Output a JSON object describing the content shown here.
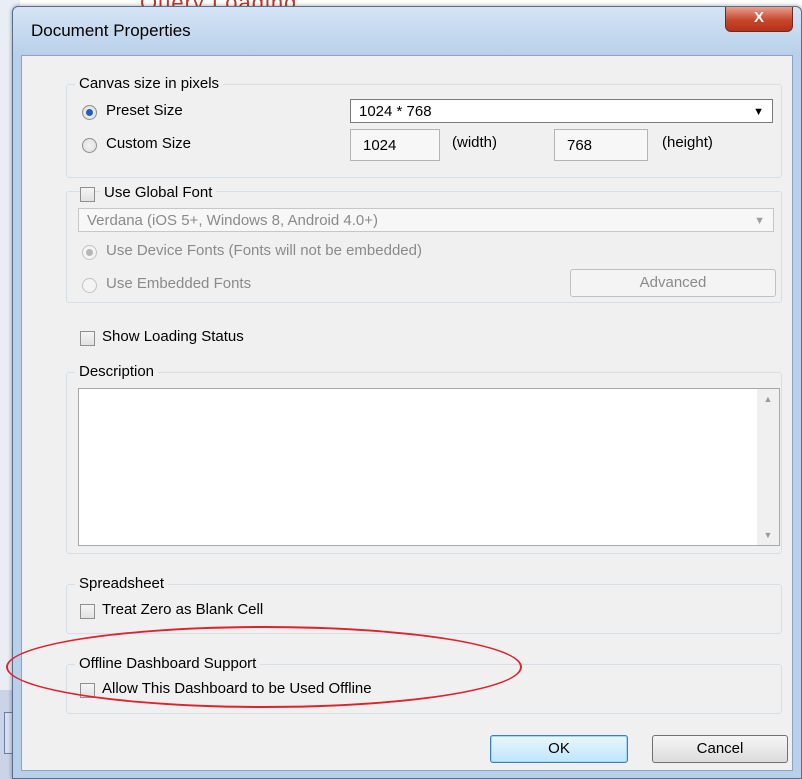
{
  "dialog": {
    "title": "Document Properties",
    "close_label": "X"
  },
  "canvas_size": {
    "legend": "Canvas size in pixels",
    "preset_label": "Preset Size",
    "preset_value": "1024 * 768",
    "custom_label": "Custom Size",
    "width_value": "1024",
    "width_unit": "(width)",
    "height_value": "768",
    "height_unit": "(height)"
  },
  "global_font": {
    "checkbox_label": "Use Global Font",
    "font_value": "Verdana (iOS 5+, Windows 8, Android 4.0+)",
    "device_fonts_label": "Use Device Fonts (Fonts will not be embedded)",
    "embedded_fonts_label": "Use Embedded Fonts",
    "advanced_label": "Advanced"
  },
  "loading_status": {
    "checkbox_label": "Show Loading Status"
  },
  "description": {
    "legend": "Description",
    "value": ""
  },
  "spreadsheet": {
    "legend": "Spreadsheet",
    "checkbox_label": "Treat Zero as Blank Cell"
  },
  "offline": {
    "legend": "Offline Dashboard Support",
    "checkbox_label": "Allow This Dashboard to be Used Offline"
  },
  "footer": {
    "ok_label": "OK",
    "cancel_label": "Cancel"
  },
  "background": {
    "peek_text": "Query Loading"
  },
  "colors": {
    "accent": "#1f5fb8",
    "annotation": "#e0202a",
    "close_button": "#c7462c"
  }
}
